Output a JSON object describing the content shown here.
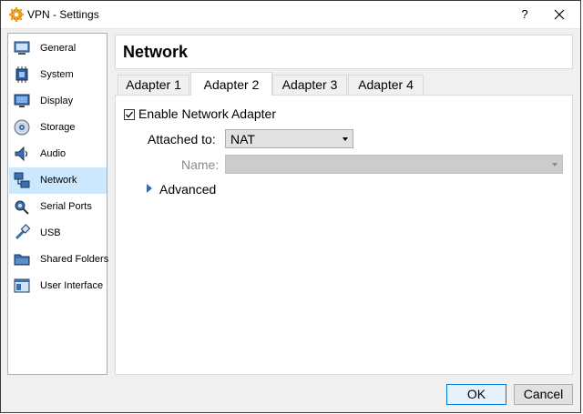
{
  "window": {
    "title": "VPN - Settings"
  },
  "titlebar": {
    "help_glyph": "?",
    "close_glyph": "✕"
  },
  "sidebar": {
    "items": [
      {
        "label": "General",
        "icon": "general-icon"
      },
      {
        "label": "System",
        "icon": "system-icon"
      },
      {
        "label": "Display",
        "icon": "display-icon"
      },
      {
        "label": "Storage",
        "icon": "storage-icon"
      },
      {
        "label": "Audio",
        "icon": "audio-icon"
      },
      {
        "label": "Network",
        "icon": "network-icon",
        "selected": true
      },
      {
        "label": "Serial Ports",
        "icon": "serial-ports-icon"
      },
      {
        "label": "USB",
        "icon": "usb-icon"
      },
      {
        "label": "Shared Folders",
        "icon": "shared-folders-icon"
      },
      {
        "label": "User Interface",
        "icon": "user-interface-icon"
      }
    ]
  },
  "main": {
    "title": "Network",
    "tabs": [
      {
        "label": "Adapter 1"
      },
      {
        "label": "Adapter 2",
        "selected": true
      },
      {
        "label": "Adapter 3"
      },
      {
        "label": "Adapter 4"
      }
    ],
    "enable_adapter": {
      "label": "Enable Network Adapter",
      "checked": true
    },
    "attached_to": {
      "label": "Attached to:",
      "value": "NAT"
    },
    "name": {
      "label": "Name:",
      "value": "",
      "disabled": true
    },
    "advanced": {
      "label": "Advanced",
      "expanded": false
    }
  },
  "buttons": {
    "ok": "OK",
    "cancel": "Cancel"
  },
  "colors": {
    "selection": "#cce8ff",
    "accent": "#0078d7",
    "advanced_arrow": "#1f6fd6"
  }
}
